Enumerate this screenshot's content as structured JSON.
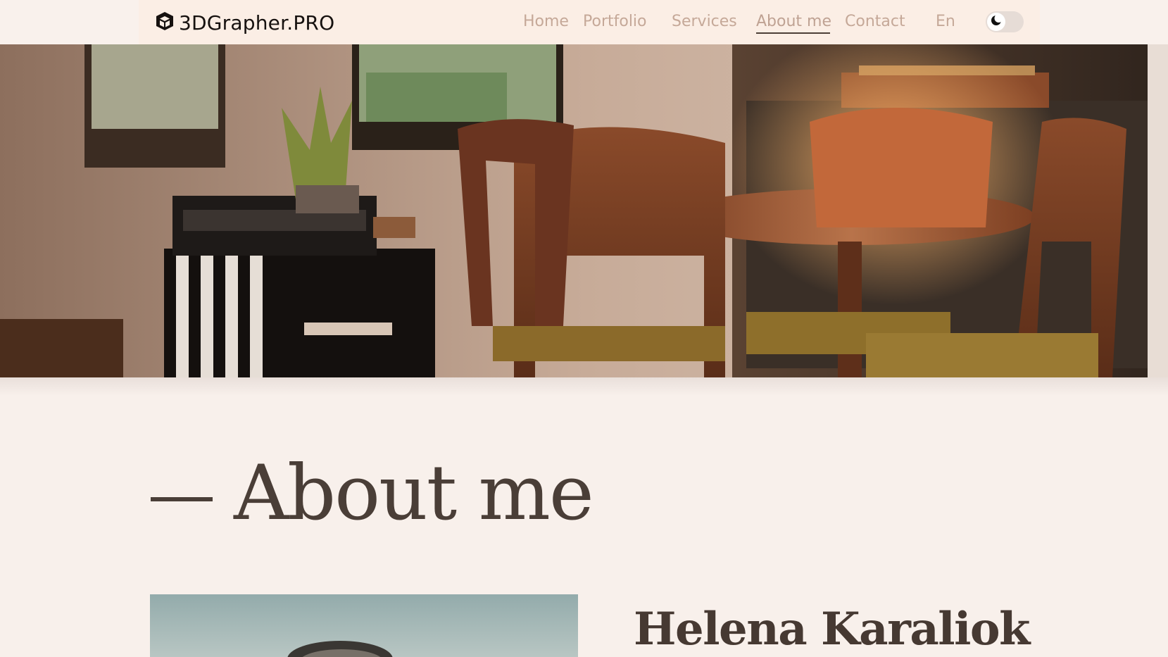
{
  "brand": {
    "name": "3DGrapher.PRO",
    "icon": "cube-icon"
  },
  "nav": {
    "items": [
      {
        "label": "Home"
      },
      {
        "label": "Portfolio"
      },
      {
        "label": "Services"
      },
      {
        "label": "About me",
        "active": true
      },
      {
        "label": "Contact"
      }
    ],
    "language": "En",
    "theme_toggle_icon": "moon-icon"
  },
  "hero": {
    "image": "interior-dining-room-render"
  },
  "about": {
    "title": "About me",
    "name": "Helena Karaliok",
    "portrait": "portrait-photo"
  },
  "colors": {
    "background": "#f8f0eb",
    "nav_panel": "#fbeee5",
    "nav_text": "#c5a898",
    "heading": "#4a3e37"
  }
}
